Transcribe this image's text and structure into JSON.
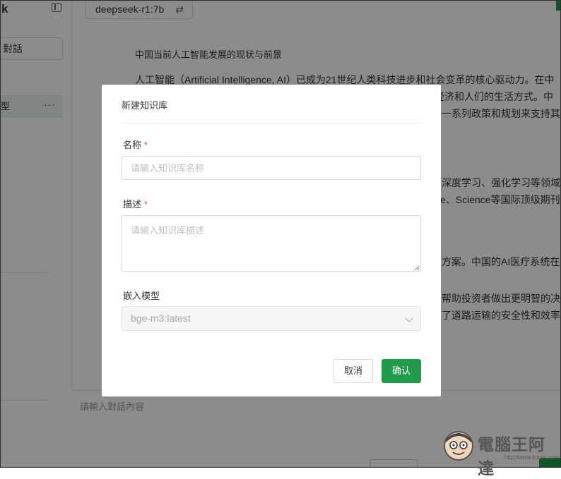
{
  "app": {
    "brand_letter": "k",
    "model_selector": "deepseek-r1:7b",
    "swap_icon": "⇄"
  },
  "sidebar": {
    "new_chat_label": "對話",
    "active_chat_label": "型",
    "active_chat_more": "···"
  },
  "article": {
    "heading": "中国当前人工智能发展的现状与前景",
    "lines": [
      "人工智能（Artificial Intelligence, AI）已成为21世纪人类科技进步和社会变革的核心驱动力。在中",
      "经济和人们的生活方式。中",
      "一系列政策和规划来支持其",
      "深度学习、强化学习等领域",
      "e、Science等国际顶级期刊",
      "方案。中国的AI医疗系统在",
      "帮助投资者做出更明智的决",
      "了道路运输的安全性和效率"
    ]
  },
  "chat_input": {
    "placeholder": "請輸入對話內容"
  },
  "dialog": {
    "title": "新建知识库",
    "name_label": "名称",
    "name_required": "*",
    "name_placeholder": "请输入知识库名称",
    "name_value": "",
    "desc_label": "描述",
    "desc_required": "*",
    "desc_placeholder": "请输入知识库描述",
    "desc_value": "",
    "embed_label": "嵌入模型",
    "embed_value": "bge-m3:latest",
    "cancel_label": "取消",
    "confirm_label": "确认"
  },
  "watermark": {
    "text": "電腦王阿達",
    "url": "http://www.kocpc.com.tw"
  },
  "colors": {
    "accent": "#1f9b4a",
    "required": "#e5484d",
    "active_item_bg": "#e8f3ec"
  }
}
